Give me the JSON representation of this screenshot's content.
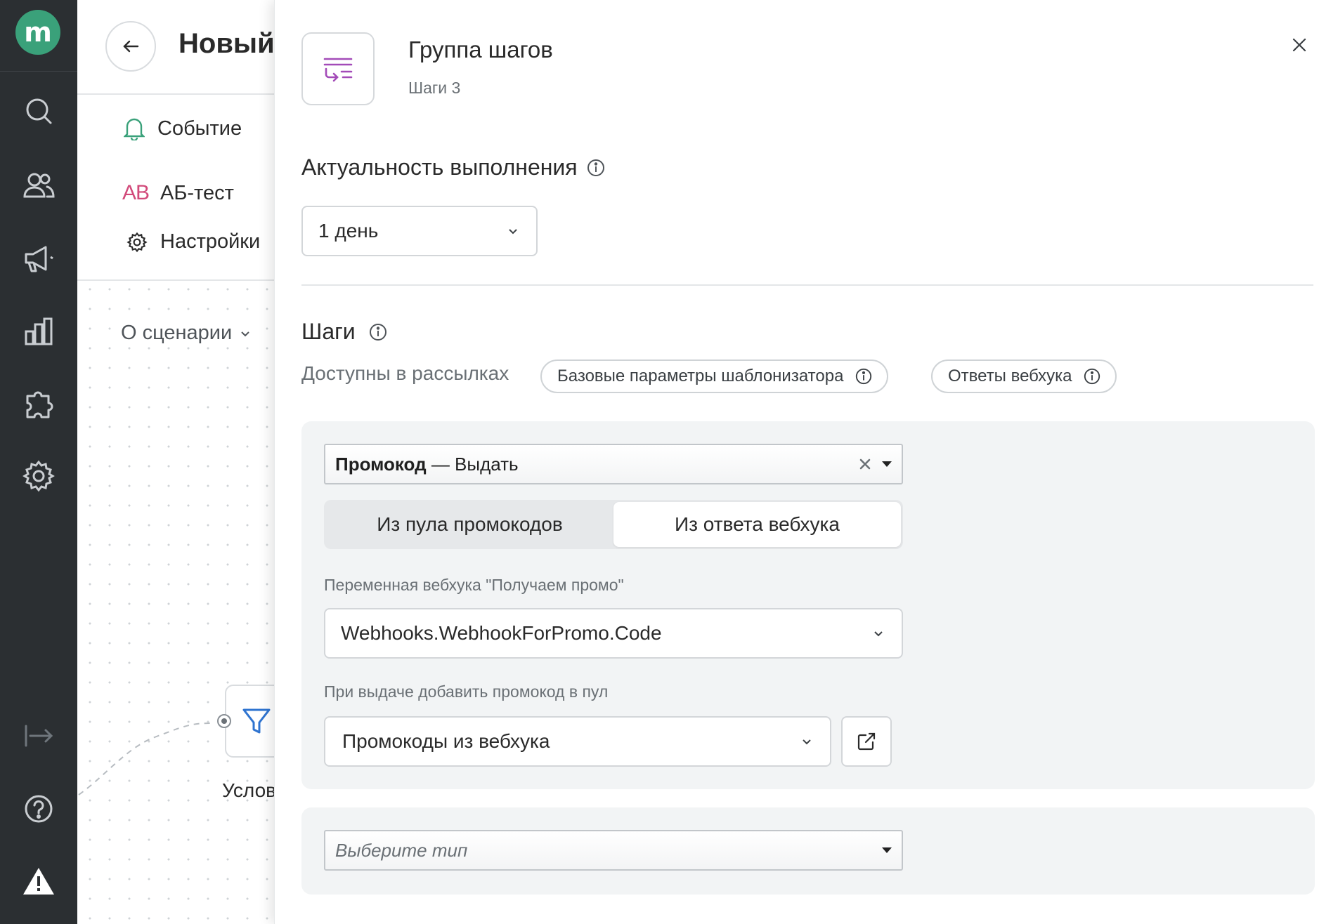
{
  "nav": {
    "logo_letter": "m",
    "items": [
      "search-icon",
      "users-icon",
      "megaphone-icon",
      "chart-icon",
      "puzzle-icon",
      "gear-icon"
    ],
    "bottom": [
      "expand-icon",
      "help-icon",
      "warning-icon"
    ],
    "brand_color": "#3aa17a"
  },
  "editor": {
    "title": "Новый",
    "menu": {
      "event": "Событие",
      "ab_badge": "AB",
      "ab_test": "АБ-тест",
      "settings": "Настройки"
    },
    "about": "О сценарии",
    "node_label": "Услов"
  },
  "drawer": {
    "title": "Группа шагов",
    "subtitle": "Шаги 3",
    "relevance": {
      "heading": "Актуальность выполнения",
      "value": "1 день"
    },
    "steps": {
      "heading": "Шаги",
      "available_label": "Доступны в рассылках",
      "pills": [
        "Базовые параметры шаблонизатора",
        "Ответы вебхука"
      ]
    },
    "step1": {
      "action_bold": "Промокод",
      "action_rest": " — Выдать",
      "segment": {
        "options": [
          "Из пула промокодов",
          "Из ответа вебхука"
        ],
        "selected": "Из ответа вебхука"
      },
      "webhook_var_label": "Переменная вебхука \"Получаем промо\"",
      "webhook_var_value": "Webhooks.WebhookForPromo.Code",
      "pool_label": "При выдаче добавить промокод в пул",
      "pool_value": "Промокоды из вебхука"
    },
    "step2": {
      "type_placeholder": "Выберите тип"
    }
  }
}
